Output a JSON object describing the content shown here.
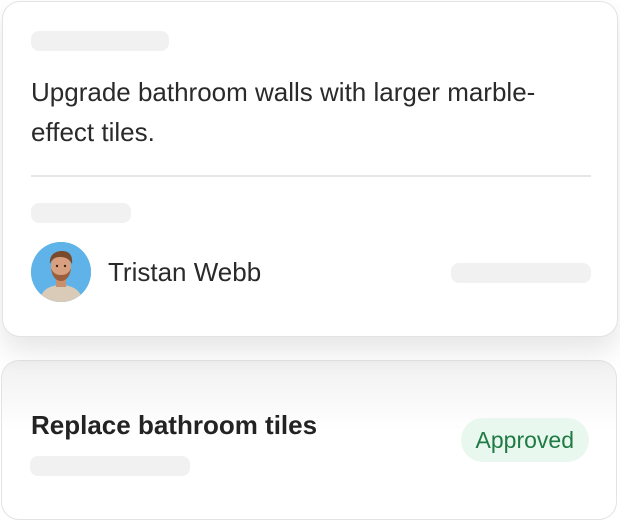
{
  "request_card": {
    "description": "Upgrade bathroom walls with larger marble-effect tiles.",
    "assignee": {
      "name": "Tristan Webb",
      "avatar_icon": "person-avatar-icon"
    }
  },
  "task_card": {
    "title": "Replace bathroom tiles",
    "status": "Approved",
    "status_color": "#1f7a43",
    "status_bg": "#e9f8ee"
  },
  "colors": {
    "skeleton": "#f1f1f1",
    "border": "#e3e3e3",
    "text": "#2a2a2a",
    "avatar_bg": "#5fb3e8"
  }
}
